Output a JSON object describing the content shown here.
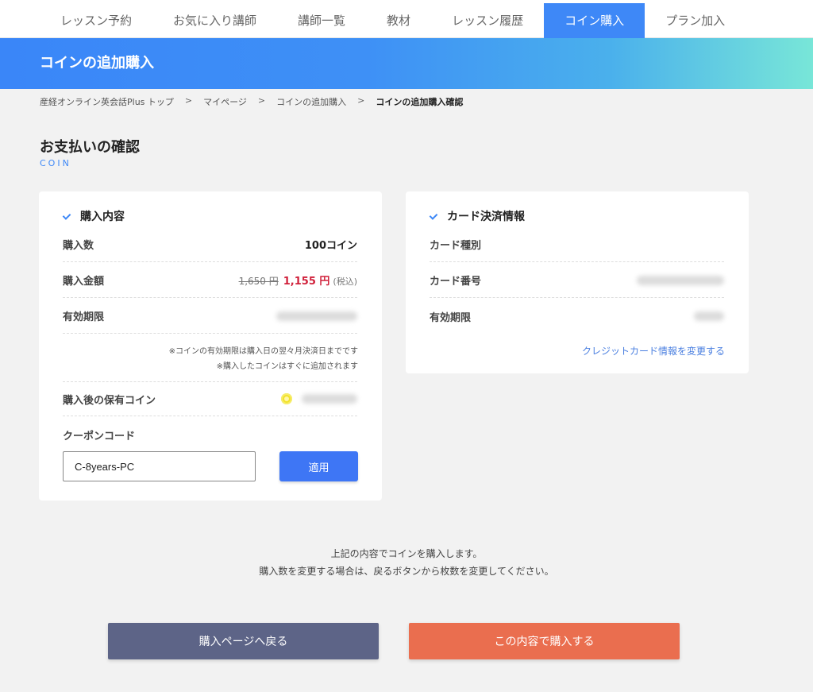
{
  "nav": {
    "tabs": [
      {
        "label": "レッスン予約"
      },
      {
        "label": "お気に入り講師"
      },
      {
        "label": "講師一覧"
      },
      {
        "label": "教材"
      },
      {
        "label": "レッスン履歴"
      },
      {
        "label": "コイン購入",
        "active": true
      },
      {
        "label": "プラン加入"
      }
    ]
  },
  "hero": {
    "title": "コインの追加購入"
  },
  "breadcrumb": {
    "items": [
      "産経オンライン英会話Plus トップ",
      "マイページ",
      "コインの追加購入",
      "コインの追加購入確認"
    ],
    "separator": ">"
  },
  "page": {
    "title": "お支払いの確認",
    "subtitle": "COIN"
  },
  "purchase": {
    "heading": "購入内容",
    "quantity_label": "購入数",
    "quantity_value": "100コイン",
    "amount_label": "購入金額",
    "amount_original": "1,650 円",
    "amount_price": "1,155 円",
    "amount_tax": "(税込)",
    "expiry_label": "有効期限",
    "note_line1": "※コインの有効期限は購入日の翌々月決済日までです",
    "note_line2": "※購入したコインはすぐに追加されます",
    "after_label": "購入後の保有コイン",
    "coupon_label": "クーポンコード",
    "coupon_value": "C-8years-PC",
    "apply_label": "適用"
  },
  "card": {
    "heading": "カード決済情報",
    "type_label": "カード種別",
    "number_label": "カード番号",
    "expiry_label": "有効期限",
    "change_link": "クレジットカード情報を変更する"
  },
  "message": {
    "line1": "上記の内容でコインを購入します。",
    "line2": "購入数を変更する場合は、戻るボタンから枚数を変更してください。"
  },
  "buttons": {
    "back": "購入ページへ戻る",
    "buy": "この内容で購入する"
  },
  "colors": {
    "accent": "#3e88f7",
    "price": "#d0203a",
    "back_button": "#5d6487",
    "buy_button": "#ea6e4f"
  }
}
